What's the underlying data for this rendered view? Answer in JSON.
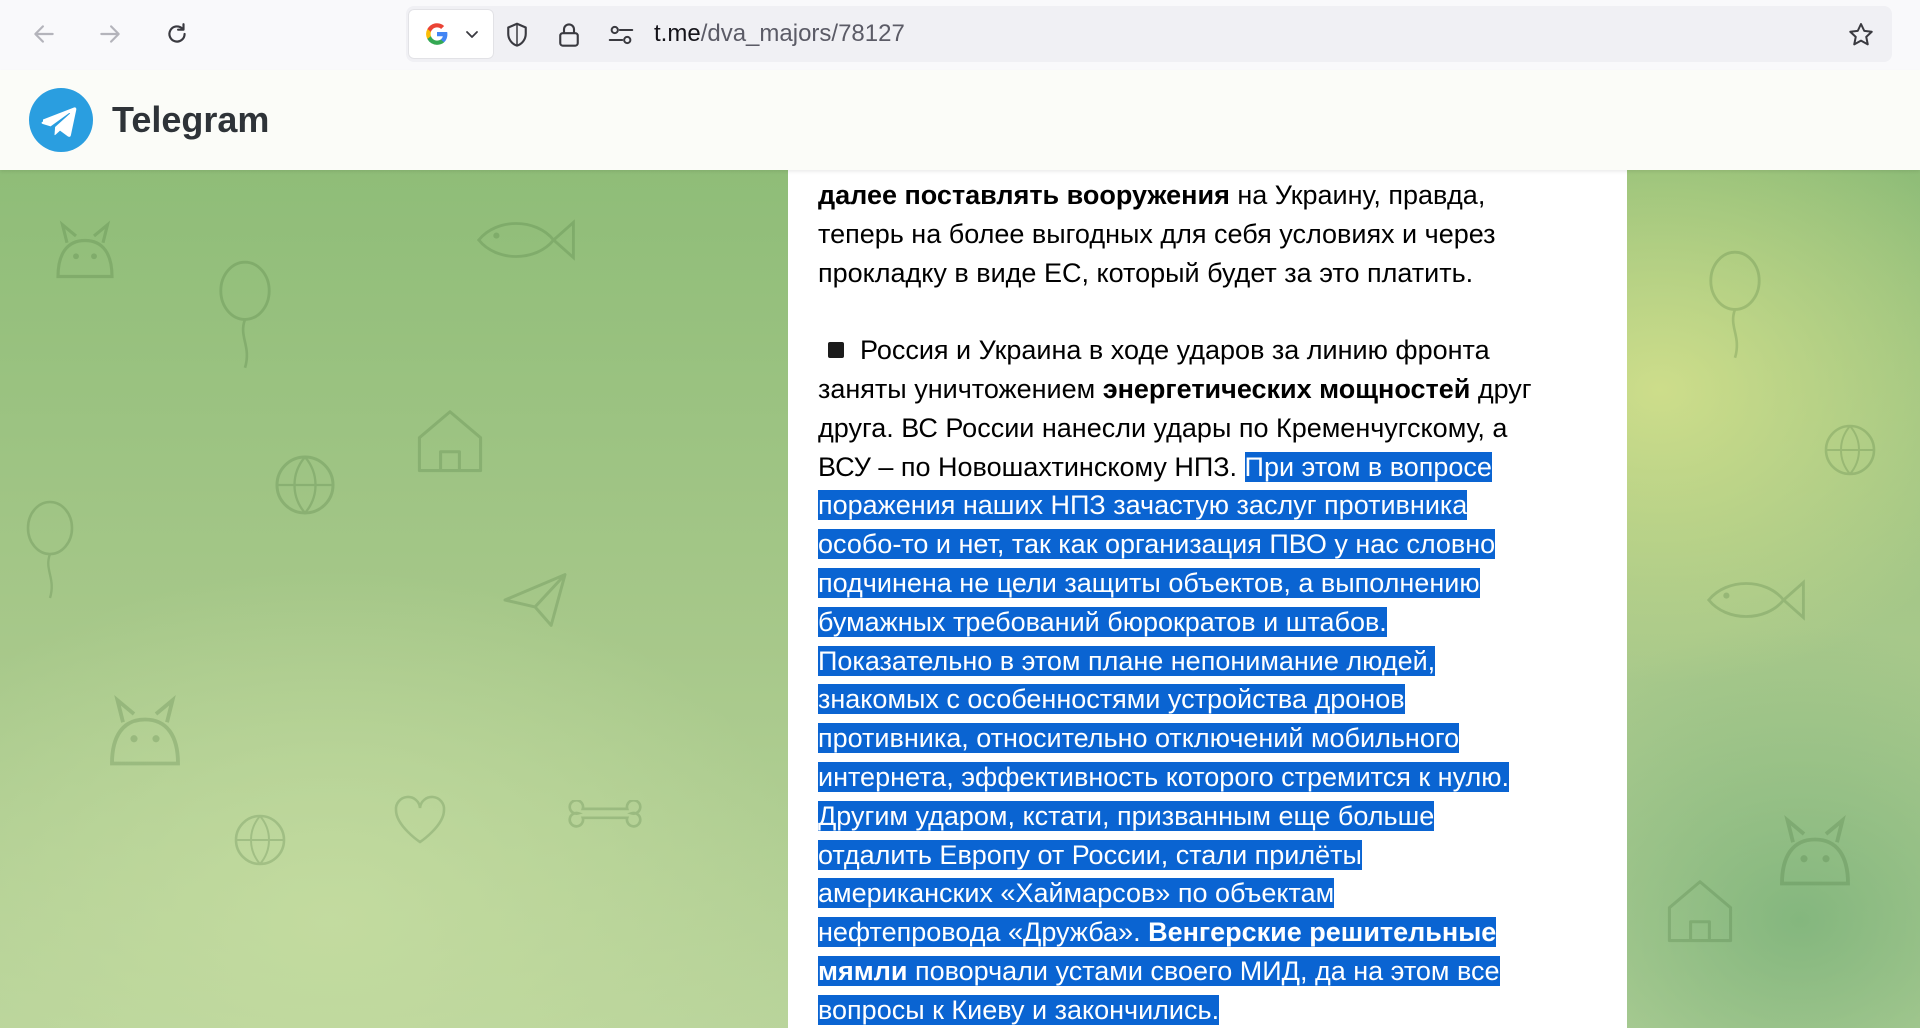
{
  "browser": {
    "url_host": "t.me",
    "url_path": "/dva_majors/78127",
    "icons": {
      "back": "arrow-left-icon",
      "forward": "arrow-right-icon",
      "reload": "reload-icon",
      "engine": "google-icon",
      "shield": "shield-icon",
      "lock": "lock-icon",
      "permissions": "permissions-icon",
      "bookmark": "star-icon"
    }
  },
  "header": {
    "title": "Telegram"
  },
  "colors": {
    "telegram_blue": "#2a9ee0",
    "selection": "#0a64d2"
  },
  "message": {
    "p1": {
      "bold": "далее поставлять вооружения",
      "rest_line1": " на Украину, правда,",
      "line2": "теперь на более выгодных для себя условиях и через",
      "line3": "прокладку в виде ЕС, который будет за это платить."
    },
    "p2": {
      "line1": "Россия и Украина в ходе ударов за линию фронта",
      "line2_pre": "заняты уничтожением ",
      "line2_bold": "энергетических мощностей",
      "line2_post": " друг",
      "line3": "друга. ВС России нанесли удары по Кременчугскому, а",
      "line4_pre": "ВСУ – по Новошахтинскому НПЗ. ",
      "sel1": "При этом в вопросе",
      "sel2": "поражения наших НПЗ зачастую заслуг противника",
      "sel3": "особо-то и нет, так как организация ПВО у нас словно",
      "sel4": "подчинена не цели защиты объектов, а выполнению",
      "sel5": "бумажных требований бюрократов и штабов.",
      "sel6": "Показательно в этом плане непонимание людей,",
      "sel7": "знакомых с особенностями устройства дронов",
      "sel8": "противника, относительно отключений мобильного",
      "sel9": "интернета, эффективность которого стремится к нулю.",
      "sel10": "Другим ударом, кстати, призванным еще больше",
      "sel11": "отдалить Европу от России, стали прилёты",
      "sel12": "американских «Хаймарсов» по объектам",
      "sel13_pre": "нефтепровода «Дружба». ",
      "sel13_bold": "Венгерские решительные",
      "sel14_bold": "мямли",
      "sel14_post": " поворчали устами своего МИД, да на этом все",
      "sel15": "вопросы к Киеву и закончились."
    }
  }
}
